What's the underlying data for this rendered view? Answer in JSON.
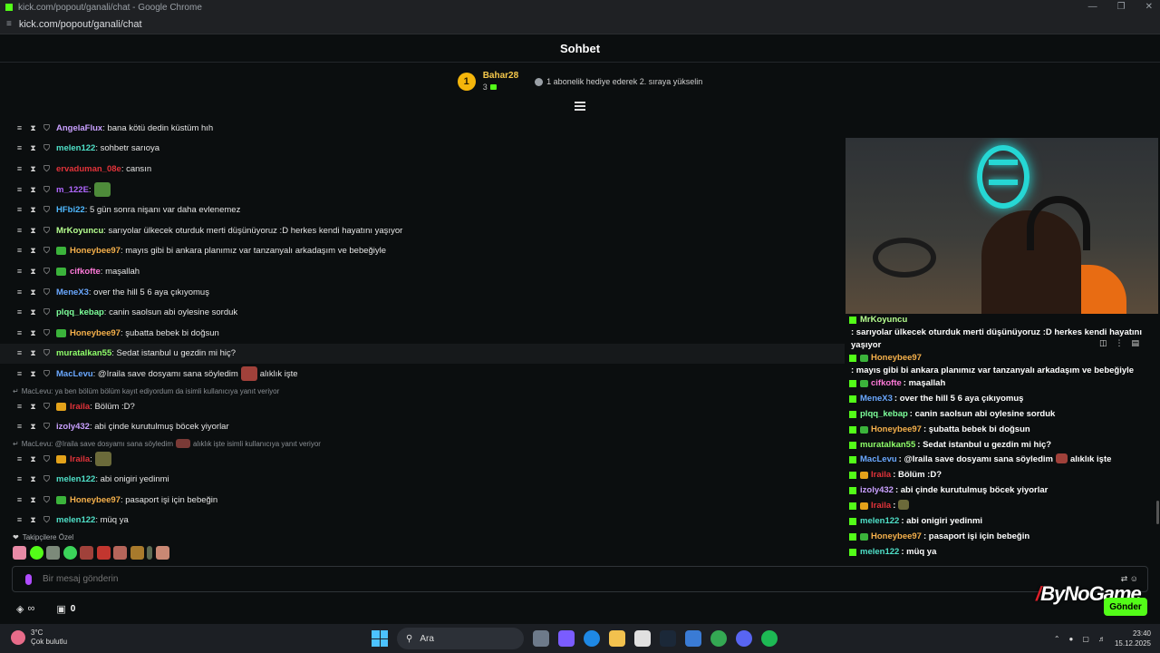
{
  "browser": {
    "window_title": "kick.com/popout/ganali/chat - Google Chrome",
    "url": "kick.com/popout/ganali/chat"
  },
  "header": {
    "title": "Sohbet"
  },
  "leaderboard": {
    "rank": "1",
    "user": "Bahar28",
    "count": "3",
    "hint": "1 abonelik hediye ederek 2. sıraya yükselin"
  },
  "colors": {
    "accent": "#53fc18",
    "highlight_gold": "#f5b60b"
  },
  "messages": [
    {
      "user": "AngelaFlux",
      "color": "#c9a0ff",
      "text": ": bana kötü dedin küstüm hıh",
      "badge": null
    },
    {
      "user": "melen122",
      "color": "#4fe0c8",
      "text": ": sohbetr sarıoya",
      "badge": null
    },
    {
      "user": "ervaduman_08e",
      "color": "#e2333a",
      "text": ": cansın",
      "badge": null
    },
    {
      "user": "m_122E",
      "color": "#b067ff",
      "text": ":",
      "badge": null,
      "emote": "pepe"
    },
    {
      "user": "HFbi22",
      "color": "#4fb8ff",
      "text": ": 5 gün sonra nişanı var daha evlenemez",
      "badge": null
    },
    {
      "user": "MrKoyuncu",
      "color": "#b6ff8f",
      "text": ": sarıyolar ülkecek oturduk merti düşünüyoruz :D herkes kendi hayatını yaşıyor",
      "badge": null
    },
    {
      "user": "Honeybee97",
      "color": "#f5b04b",
      "text": ": mayıs gibi bi ankara planımız var tanzanyalı arkadaşım ve bebeğiyle",
      "badge": "sub"
    },
    {
      "user": "cifkofte",
      "color": "#ff7ad9",
      "text": ": maşallah",
      "badge": "sub"
    },
    {
      "user": "MeneX3",
      "color": "#6aa8ff",
      "text": ": over the hill 5 6 aya çıkıyomuş",
      "badge": null
    },
    {
      "user": "plqq_kebap",
      "color": "#7dff9a",
      "text": ": canin saolsun abi oylesine sorduk",
      "badge": null
    },
    {
      "user": "Honeybee97",
      "color": "#f5b04b",
      "text": ": şubatta bebek bi doğsun",
      "badge": "sub"
    },
    {
      "user": "muratalkan55",
      "color": "#8fff6a",
      "text": ": Sedat istanbul u gezdin mi hiç?",
      "badge": null
    },
    {
      "user": "MacLevu",
      "color": "#6aa8ff",
      "text": ": @Iraila save dosyamı sana söyledim",
      "text2": "alıklık işte",
      "badge": null,
      "emote": "face"
    }
  ],
  "reply1": {
    "text": "MacLevu: ya ben bölüm bölüm kayıt ediyordum da isimli kullanıcıya yanıt veriyor"
  },
  "msg_iraila1": {
    "user": "Iraila",
    "color": "#e2333a",
    "text": ": Bölüm :D?"
  },
  "msg_izoly": {
    "user": "izoly432",
    "color": "#c9a0ff",
    "text": ": abi çinde kurutulmuş böcek yiyorlar"
  },
  "reply2": {
    "pre": "MacLevu: @Iraila save dosyamı sana söyledim",
    "post": "alıklık işte isimli kullanıcıya yanıt veriyor"
  },
  "msg_iraila2": {
    "user": "Iraila",
    "color": "#e2333a",
    "text": ":"
  },
  "tail_messages": [
    {
      "user": "melen122",
      "color": "#4fe0c8",
      "text": ": abi onigiri yedinmi",
      "badge": null
    },
    {
      "user": "Honeybee97",
      "color": "#f5b04b",
      "text": ": pasaport işi için bebeğin",
      "badge": "sub"
    },
    {
      "user": "melen122",
      "color": "#4fe0c8",
      "text": ": müq ya",
      "badge": null
    }
  ],
  "overlay": {
    "rows": [
      {
        "user": "MrKoyuncu",
        "color": "#b6ff8f",
        "text": ": sarıyolar ülkecek oturduk merti düşünüyoruz :D herkes kendi hayatını yaşıyor"
      },
      {
        "user": "Honeybee97",
        "color": "#f5b04b",
        "text": ": mayıs gibi bi ankara planımız var tanzanyalı arkadaşım ve bebeğiyle"
      },
      {
        "user": "cifkofte",
        "color": "#ff7ad9",
        "text": ": maşallah"
      },
      {
        "user": "MeneX3",
        "color": "#6aa8ff",
        "text": ": over the hill 5 6 aya çıkıyomuş"
      },
      {
        "user": "plqq_kebap",
        "color": "#7dff9a",
        "text": ": canin saolsun abi oylesine sorduk"
      },
      {
        "user": "Honeybee97",
        "color": "#f5b04b",
        "text": ": şubatta bebek bi doğsun"
      },
      {
        "user": "muratalkan55",
        "color": "#8fff6a",
        "text": ": Sedat istanbul u gezdin mi hiç?"
      },
      {
        "user": "MacLevu",
        "color": "#6aa8ff",
        "text": ": @Iraila save dosyamı sana söyledim",
        "text2": "alıklık işte"
      },
      {
        "user": "Iraila",
        "color": "#e2333a",
        "text": ": Bölüm :D?"
      },
      {
        "user": "izoly432",
        "color": "#c9a0ff",
        "text": ": abi çinde kurutulmuş böcek yiyorlar"
      },
      {
        "user": "Iraila",
        "color": "#e2333a",
        "text": ":"
      },
      {
        "user": "melen122",
        "color": "#4fe0c8",
        "text": ": abi onigiri yedinmi"
      },
      {
        "user": "Honeybee97",
        "color": "#f5b04b",
        "text": ": pasaport işi için bebeğin"
      },
      {
        "user": "melen122",
        "color": "#4fe0c8",
        "text": ": müq ya"
      }
    ]
  },
  "followers_label": "Takipçilere Özel",
  "input": {
    "placeholder": "Bir mesaj gönderin"
  },
  "bottom": {
    "gift_count": "0",
    "send_label": "Gönder"
  },
  "watermark": {
    "text": "ByNoGame"
  },
  "taskbar": {
    "temp": "3°C",
    "weather": "Çok bulutlu",
    "search": "Ara",
    "time": "23:40",
    "date": "15.12.2025"
  }
}
